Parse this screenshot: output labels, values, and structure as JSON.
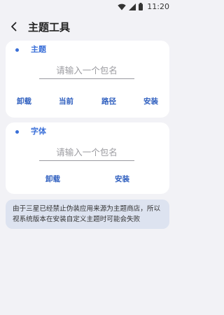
{
  "status_bar": {
    "time": "11:20",
    "icons": [
      "wifi-icon",
      "signal-icon",
      "battery-icon"
    ]
  },
  "app_bar": {
    "back_icon": "back-arrow-icon",
    "title": "主题工具"
  },
  "theme_card": {
    "title": "主题",
    "input_placeholder": "请输入一个包名",
    "input_value": "",
    "actions": [
      "卸载",
      "当前",
      "路径",
      "安装"
    ]
  },
  "font_card": {
    "title": "字体",
    "input_placeholder": "请输入一个包名",
    "input_value": "",
    "actions": [
      "卸载",
      "安装"
    ]
  },
  "notice": {
    "text": "由于三星已经禁止伪装应用来源为主题商店，所以视系统版本在安装自定义主题时可能会失败"
  },
  "colors": {
    "accent": "#3a6fd8",
    "background": "#f2f2f6",
    "card": "#ffffff",
    "notice_background": "#dde3f0"
  }
}
